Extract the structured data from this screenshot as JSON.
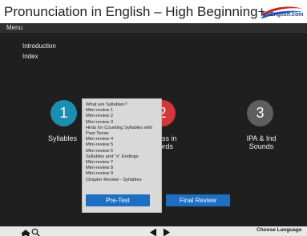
{
  "header": {
    "title": "Pronunciation in English – High Beginning+",
    "logo_text": "AmEnglish.com"
  },
  "menubar": {
    "menu_label": "Menu"
  },
  "nav": {
    "items": [
      {
        "label": "Introduction"
      },
      {
        "label": "Index"
      }
    ]
  },
  "sections": [
    {
      "number": "1",
      "label": "Syllables",
      "color": "#1b8fb0"
    },
    {
      "number": "2",
      "label": "Stress in Words",
      "color": "#d0383c"
    },
    {
      "number": "3",
      "label": "IPA & Ind Sounds",
      "color": "#5e5e5e"
    }
  ],
  "popup": {
    "items": [
      "What are Syllables?",
      "Mini-review 1",
      "Mini-review 2",
      "Mini-review 3",
      "Hints for Counting Syllables with Past Tense",
      "Mini-review 4",
      "Mini-review 5",
      "Mini-review 6",
      "Syllables and \"s\" Endings",
      "Mini-review 7",
      "Mini-review 8",
      "Mini-review 9",
      "Chapter Review - Syllables"
    ]
  },
  "buttons": {
    "pretest_label": "Pre-Test",
    "final_label": "Final Review"
  },
  "footer": {
    "language_label": "Choose Language",
    "icons": [
      "home-icon",
      "search-icon",
      "prev-arrow-icon",
      "next-arrow-icon"
    ]
  },
  "colors": {
    "background": "#1f1f1f",
    "header_bg": "#ffffff",
    "accent_blue": "#1d6fc4",
    "circle_teal": "#1b8fb0",
    "circle_red": "#d0383c",
    "circle_gray": "#5e5e5e"
  }
}
